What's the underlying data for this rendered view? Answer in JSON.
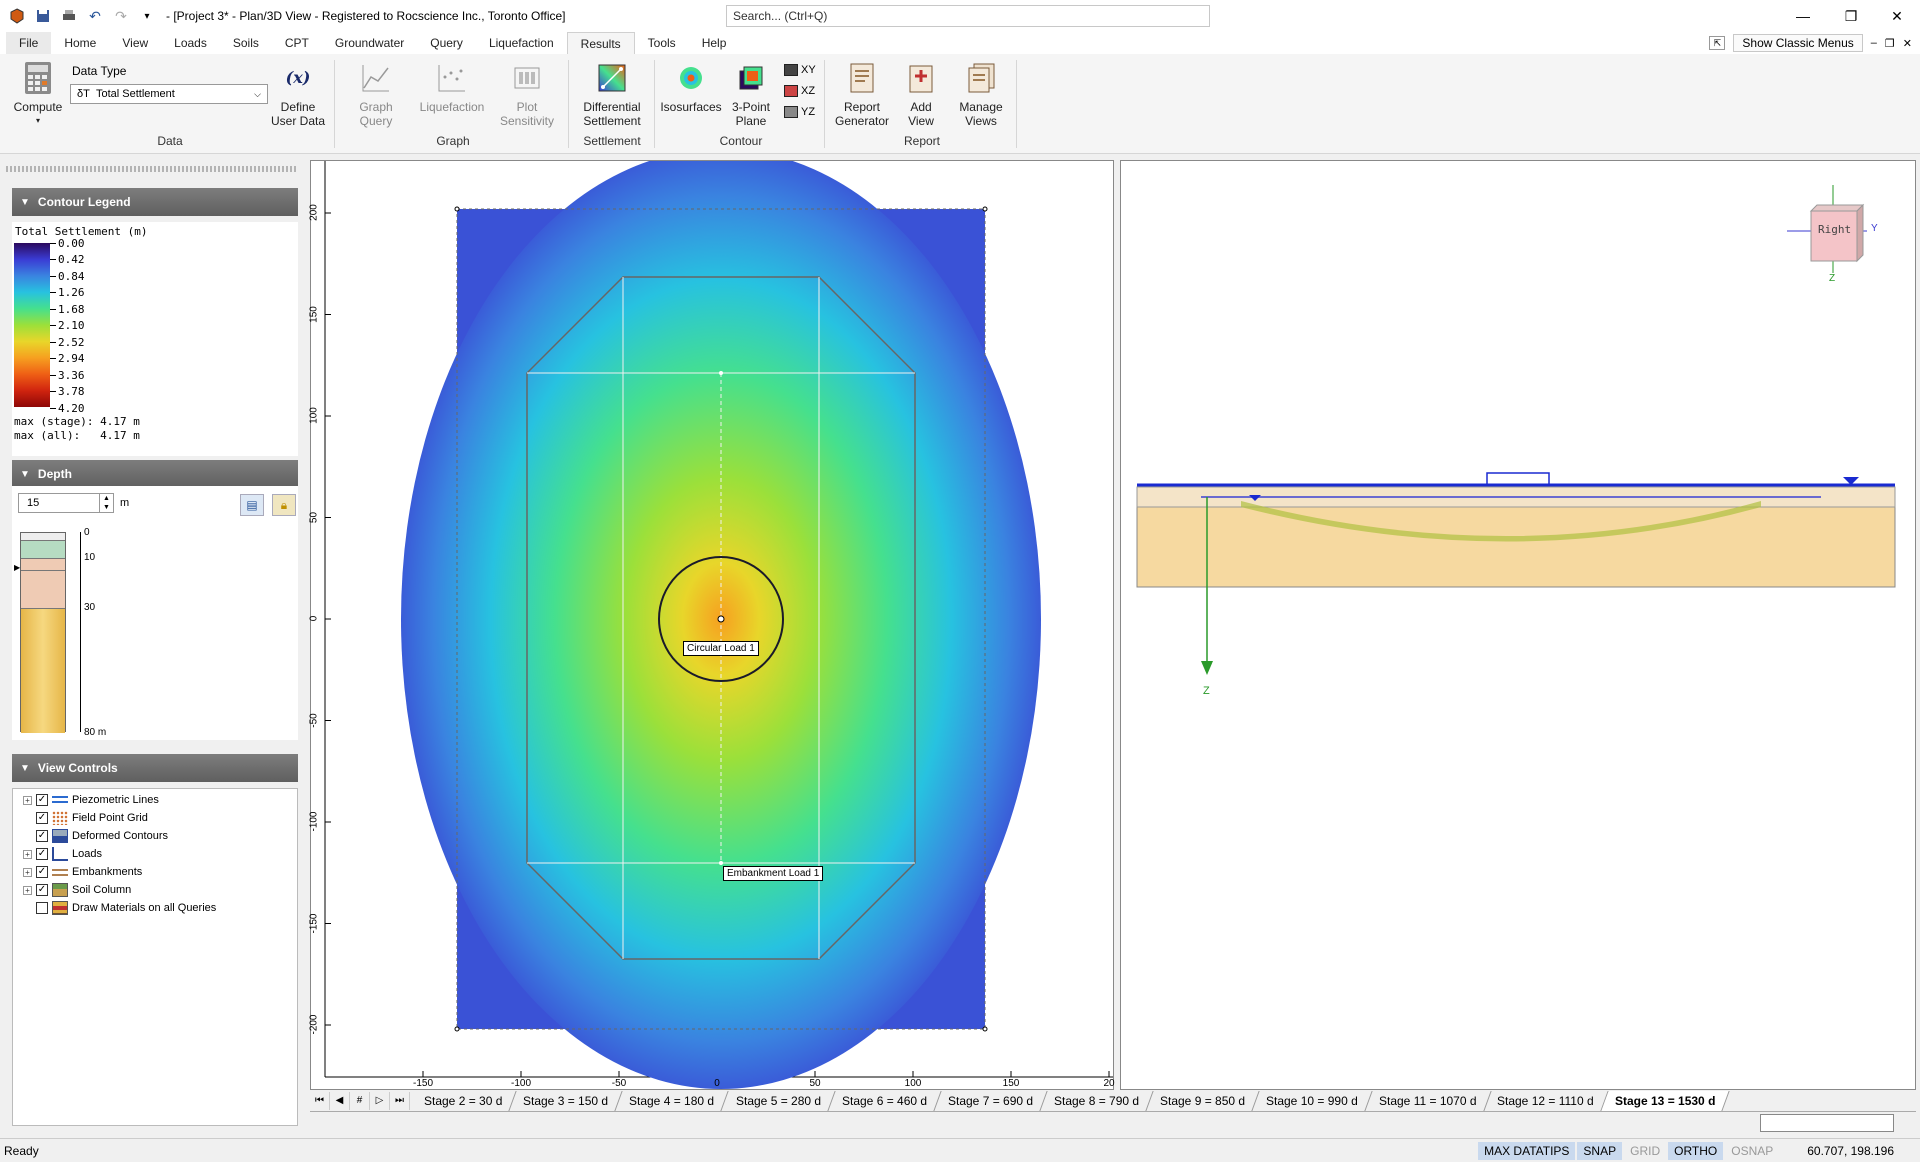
{
  "window": {
    "title": "- [Project 3* - Plan/3D View - Registered to Rocscience Inc., Toronto Office]",
    "search_placeholder": "Search... (Ctrl+Q)"
  },
  "menu": {
    "items": [
      "File",
      "Home",
      "View",
      "Loads",
      "Soils",
      "CPT",
      "Groundwater",
      "Query",
      "Liquefaction",
      "Results",
      "Tools",
      "Help"
    ],
    "active": "Results",
    "show_classic": "Show Classic Menus"
  },
  "ribbon": {
    "compute": "Compute",
    "data_type_label": "Data Type",
    "data_type_value": "Total Settlement",
    "data_type_symbol": "δT",
    "define_user_data": [
      "Define",
      "User Data"
    ],
    "group_data": "Data",
    "graph_query": [
      "Graph",
      "Query"
    ],
    "liquefaction": "Liquefaction",
    "plot_sensitivity": [
      "Plot",
      "Sensitivity"
    ],
    "group_graph": "Graph",
    "differential_settlement": [
      "Differential",
      "Settlement"
    ],
    "group_settlement": "Settlement",
    "isosurfaces": "Isosurfaces",
    "three_point_plane": [
      "3-Point",
      "Plane"
    ],
    "xy": "XY",
    "xz": "XZ",
    "yz": "YZ",
    "group_contour": "Contour",
    "report_generator": [
      "Report",
      "Generator"
    ],
    "add_view": [
      "Add",
      "View"
    ],
    "manage_views": [
      "Manage",
      "Views"
    ],
    "group_report": "Report"
  },
  "legend": {
    "header": "Contour Legend",
    "title": "Total Settlement (m)",
    "values": [
      "0.00",
      "0.42",
      "0.84",
      "1.26",
      "1.68",
      "2.10",
      "2.52",
      "2.94",
      "3.36",
      "3.78",
      "4.20"
    ],
    "max_stage": "max (stage): 4.17 m",
    "max_all": "max (all):   4.17 m"
  },
  "depth": {
    "header": "Depth",
    "value": "15",
    "unit": "m",
    "ticks": [
      "0",
      "10",
      "30",
      "80 m"
    ]
  },
  "view_controls": {
    "header": "View Controls",
    "items": [
      {
        "label": "Piezometric Lines",
        "checked": true,
        "expandable": true
      },
      {
        "label": "Field Point Grid",
        "checked": true,
        "expandable": false
      },
      {
        "label": "Deformed Contours",
        "checked": true,
        "expandable": false
      },
      {
        "label": "Loads",
        "checked": true,
        "expandable": true
      },
      {
        "label": "Embankments",
        "checked": true,
        "expandable": true
      },
      {
        "label": "Soil Column",
        "checked": true,
        "expandable": true
      },
      {
        "label": "Draw Materials on all Queries",
        "checked": false,
        "expandable": false
      }
    ]
  },
  "plan_view": {
    "y_ticks": [
      "200",
      "150",
      "100",
      "50",
      "0",
      "-50",
      "-100",
      "-150",
      "-200"
    ],
    "x_ticks": [
      "-150",
      "-100",
      "-50",
      "0",
      "50",
      "100",
      "150",
      "20"
    ],
    "circular_load": "Circular Load 1",
    "embankment_load": "Embankment Load 1"
  },
  "section_view": {
    "cube_label": "Right",
    "axis_y": "Y",
    "axis_z": "Z",
    "axis_z_main": "Z"
  },
  "stages": {
    "items": [
      "Stage 2 = 30 d",
      "Stage 3 = 150 d",
      "Stage 4 = 180 d",
      "Stage 5 = 280 d",
      "Stage 6 = 460 d",
      "Stage 7 = 690 d",
      "Stage 8 = 790 d",
      "Stage 9 = 850 d",
      "Stage 10 = 990 d",
      "Stage 11 = 1070 d",
      "Stage 12 = 1110 d",
      "Stage 13 = 1530 d"
    ],
    "active": "Stage 13 = 1530 d"
  },
  "status": {
    "ready": "Ready",
    "flags": [
      {
        "label": "MAX DATATIPS",
        "on": true
      },
      {
        "label": "SNAP",
        "on": true
      },
      {
        "label": "GRID",
        "on": false
      },
      {
        "label": "ORTHO",
        "on": true
      },
      {
        "label": "OSNAP",
        "on": false
      }
    ],
    "coords": "60.707, 198.196"
  },
  "colors": {
    "accent": "#2b579a",
    "contour_low": "#3a3cd4",
    "contour_high": "#d0240f"
  }
}
